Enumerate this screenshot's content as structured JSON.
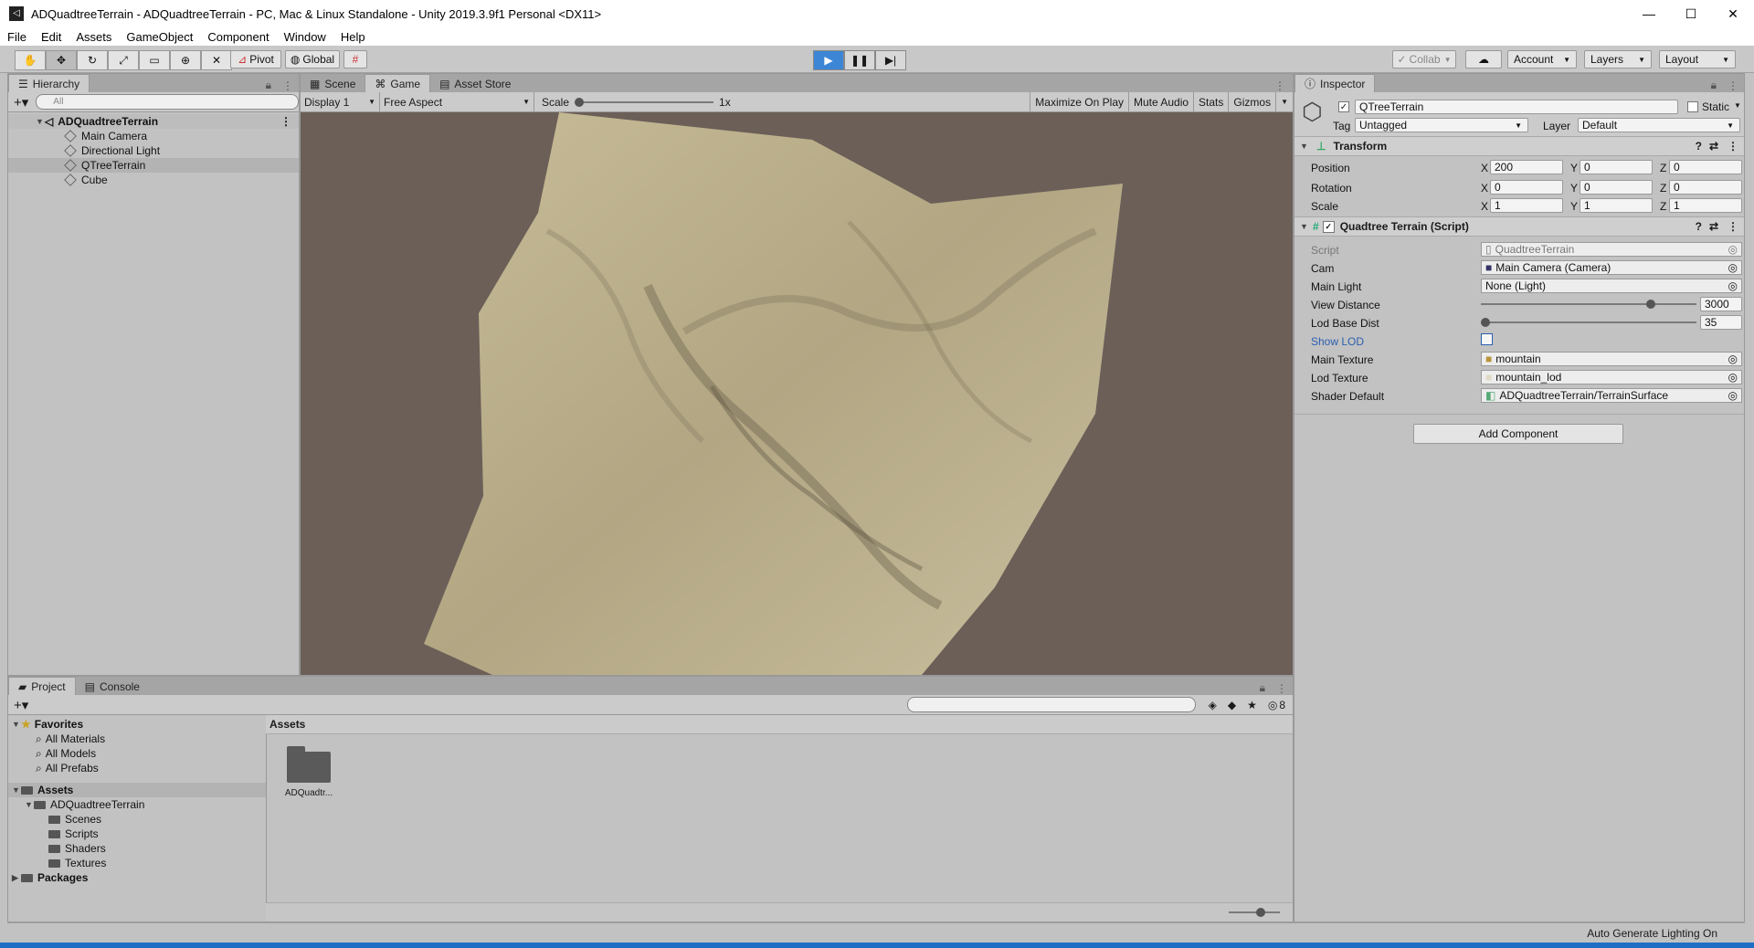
{
  "window": {
    "title": "ADQuadtreeTerrain - ADQuadtreeTerrain - PC, Mac & Linux Standalone - Unity 2019.3.9f1 Personal <DX11>",
    "minimize": "—",
    "maximize": "☐",
    "close": "✕"
  },
  "menu": [
    "File",
    "Edit",
    "Assets",
    "GameObject",
    "Component",
    "Window",
    "Help"
  ],
  "toolbar": {
    "pivot": "Pivot",
    "global": "Global",
    "collab": "Collab",
    "account": "Account",
    "layers": "Layers",
    "layout": "Layout",
    "accent": "#3d86d6"
  },
  "hierarchy": {
    "tab": "Hierarchy",
    "search_placeholder": "All",
    "scene": "ADQuadtreeTerrain",
    "items": [
      "Main Camera",
      "Directional Light",
      "QTreeTerrain",
      "Cube"
    ],
    "selected_index": 2
  },
  "game": {
    "tabs": [
      "Scene",
      "Game",
      "Asset Store"
    ],
    "active_tab": "Game",
    "display": "Display 1",
    "aspect": "Free Aspect",
    "scale_label": "Scale",
    "scale_value": "1x",
    "options": [
      "Maximize On Play",
      "Mute Audio",
      "Stats",
      "Gizmos"
    ],
    "background": "#6b5f58"
  },
  "inspector": {
    "tab": "Inspector",
    "object_name": "QTreeTerrain",
    "static_label": "Static",
    "tag_label": "Tag",
    "tag_value": "Untagged",
    "layer_label": "Layer",
    "layer_value": "Default",
    "transform": {
      "title": "Transform",
      "rows": [
        {
          "label": "Position",
          "x": "200",
          "y": "0",
          "z": "0"
        },
        {
          "label": "Rotation",
          "x": "0",
          "y": "0",
          "z": "0"
        },
        {
          "label": "Scale",
          "x": "1",
          "y": "1",
          "z": "1"
        }
      ]
    },
    "script": {
      "title": "Quadtree Terrain (Script)",
      "script_label": "Script",
      "script_value": "QuadtreeTerrain",
      "cam_label": "Cam",
      "cam_value": "Main Camera (Camera)",
      "light_label": "Main Light",
      "light_value": "None (Light)",
      "view_label": "View Distance",
      "view_value": "3000",
      "view_fraction": 0.8,
      "lod_label": "Lod Base Dist",
      "lod_value": "35",
      "lod_fraction": 0.0,
      "showlod_label": "Show LOD",
      "maintex_label": "Main Texture",
      "maintex_value": "mountain",
      "lodtex_label": "Lod Texture",
      "lodtex_value": "mountain_lod",
      "shader_label": "Shader Default",
      "shader_value": "ADQuadtreeTerrain/TerrainSurface"
    },
    "add_component": "Add Component"
  },
  "project": {
    "tabs": [
      "Project",
      "Console"
    ],
    "favorites": {
      "title": "Favorites",
      "items": [
        "All Materials",
        "All Models",
        "All Prefabs"
      ]
    },
    "assets": {
      "title": "Assets",
      "root": "ADQuadtreeTerrain",
      "children": [
        "Scenes",
        "Scripts",
        "Shaders",
        "Textures"
      ]
    },
    "packages": "Packages",
    "breadcrumb": "Assets",
    "grid_items": [
      "ADQuadtr..."
    ],
    "hidden_count": "8"
  },
  "status": {
    "right_text": "Auto Generate Lighting On"
  }
}
